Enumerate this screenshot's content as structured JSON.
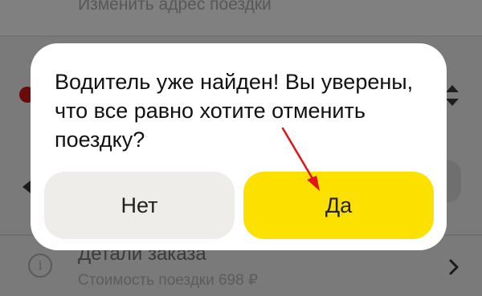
{
  "background": {
    "top_row_text": "Изменить адрес поездки",
    "details_title": "Детали заказа",
    "details_subtitle": "Стоимость поездки 698 ₽"
  },
  "dialog": {
    "message": "Водитель уже найден! Вы уверены, что все равно хотите отменить поездку?",
    "no_label": "Нет",
    "yes_label": "Да"
  },
  "colors": {
    "accent_yellow": "#fce000",
    "secondary_button": "#efedea",
    "annotation_arrow": "#e0151c"
  },
  "icons": {
    "info": "info-icon",
    "chevron": "chevron-right-icon",
    "sort": "sort-updown-icon",
    "annotation": "red-arrow-annotation"
  }
}
